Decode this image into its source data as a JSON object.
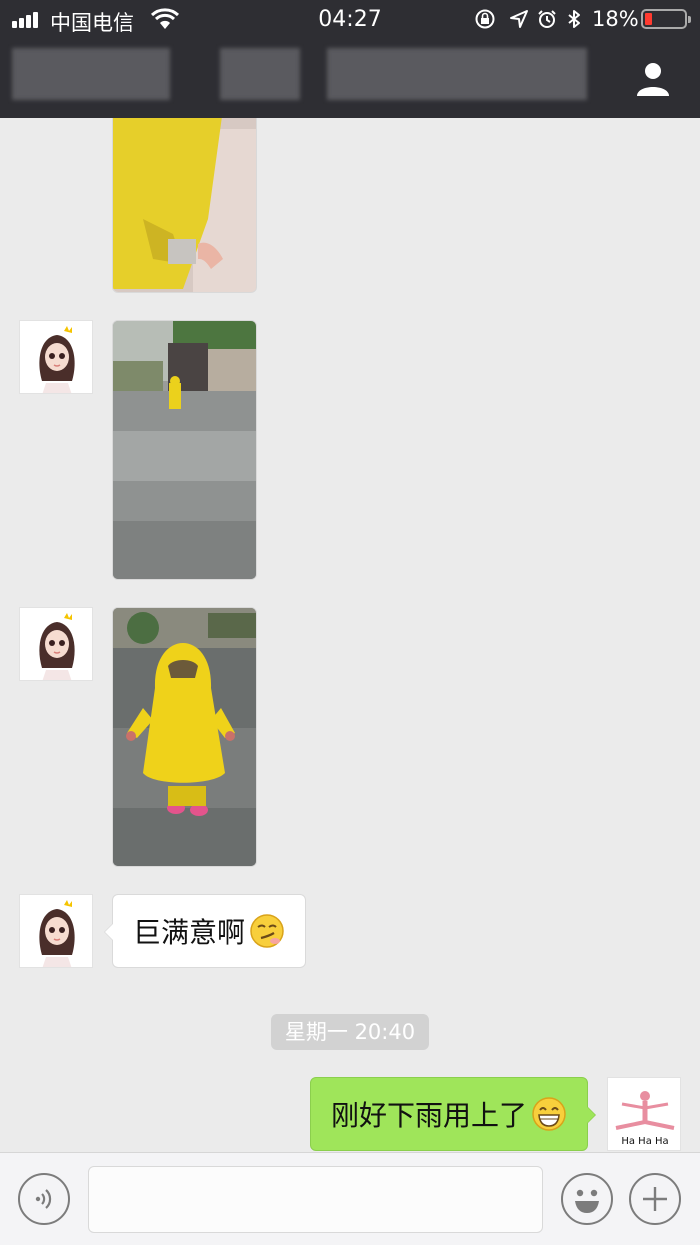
{
  "status_bar": {
    "carrier": "中国电信",
    "time": "04:27",
    "battery_percent": "18%",
    "battery_level": 0.18,
    "icons": [
      "signal-icon",
      "wifi-icon",
      "rotation-lock-icon",
      "location-arrow-icon",
      "alarm-icon",
      "bluetooth-icon",
      "battery-icon"
    ]
  },
  "nav_bar": {
    "right_icon": "profile-icon"
  },
  "messages": [
    {
      "direction": "incoming",
      "type": "image",
      "content": "child-in-yellow-raincoat-photo"
    },
    {
      "direction": "incoming",
      "type": "image",
      "content": "child-in-rain-yard-photo"
    },
    {
      "direction": "incoming",
      "type": "image",
      "content": "child-yellow-raincoat-standing-photo"
    },
    {
      "direction": "incoming",
      "type": "text",
      "text": "巨满意啊",
      "emoji": "smirk-emoji"
    },
    {
      "type": "timestamp",
      "text": "星期一 20:40"
    },
    {
      "direction": "outgoing",
      "type": "text",
      "text": "刚好下雨用上了",
      "emoji": "grin-emoji"
    }
  ],
  "avatars": {
    "incoming": "girl-avatar",
    "outgoing": "ha-ha-ha-avatar",
    "outgoing_logo_text": "Ha Ha Ha"
  },
  "input_bar": {
    "value": "",
    "icons": [
      "voice-icon",
      "emoji-icon",
      "plus-icon"
    ]
  },
  "colors": {
    "header_bg": "#2e2e33",
    "chat_bg": "#ebebeb",
    "outgoing_bubble": "#9fe55a",
    "incoming_bubble": "#ffffff",
    "battery_low": "#ff3b30"
  }
}
